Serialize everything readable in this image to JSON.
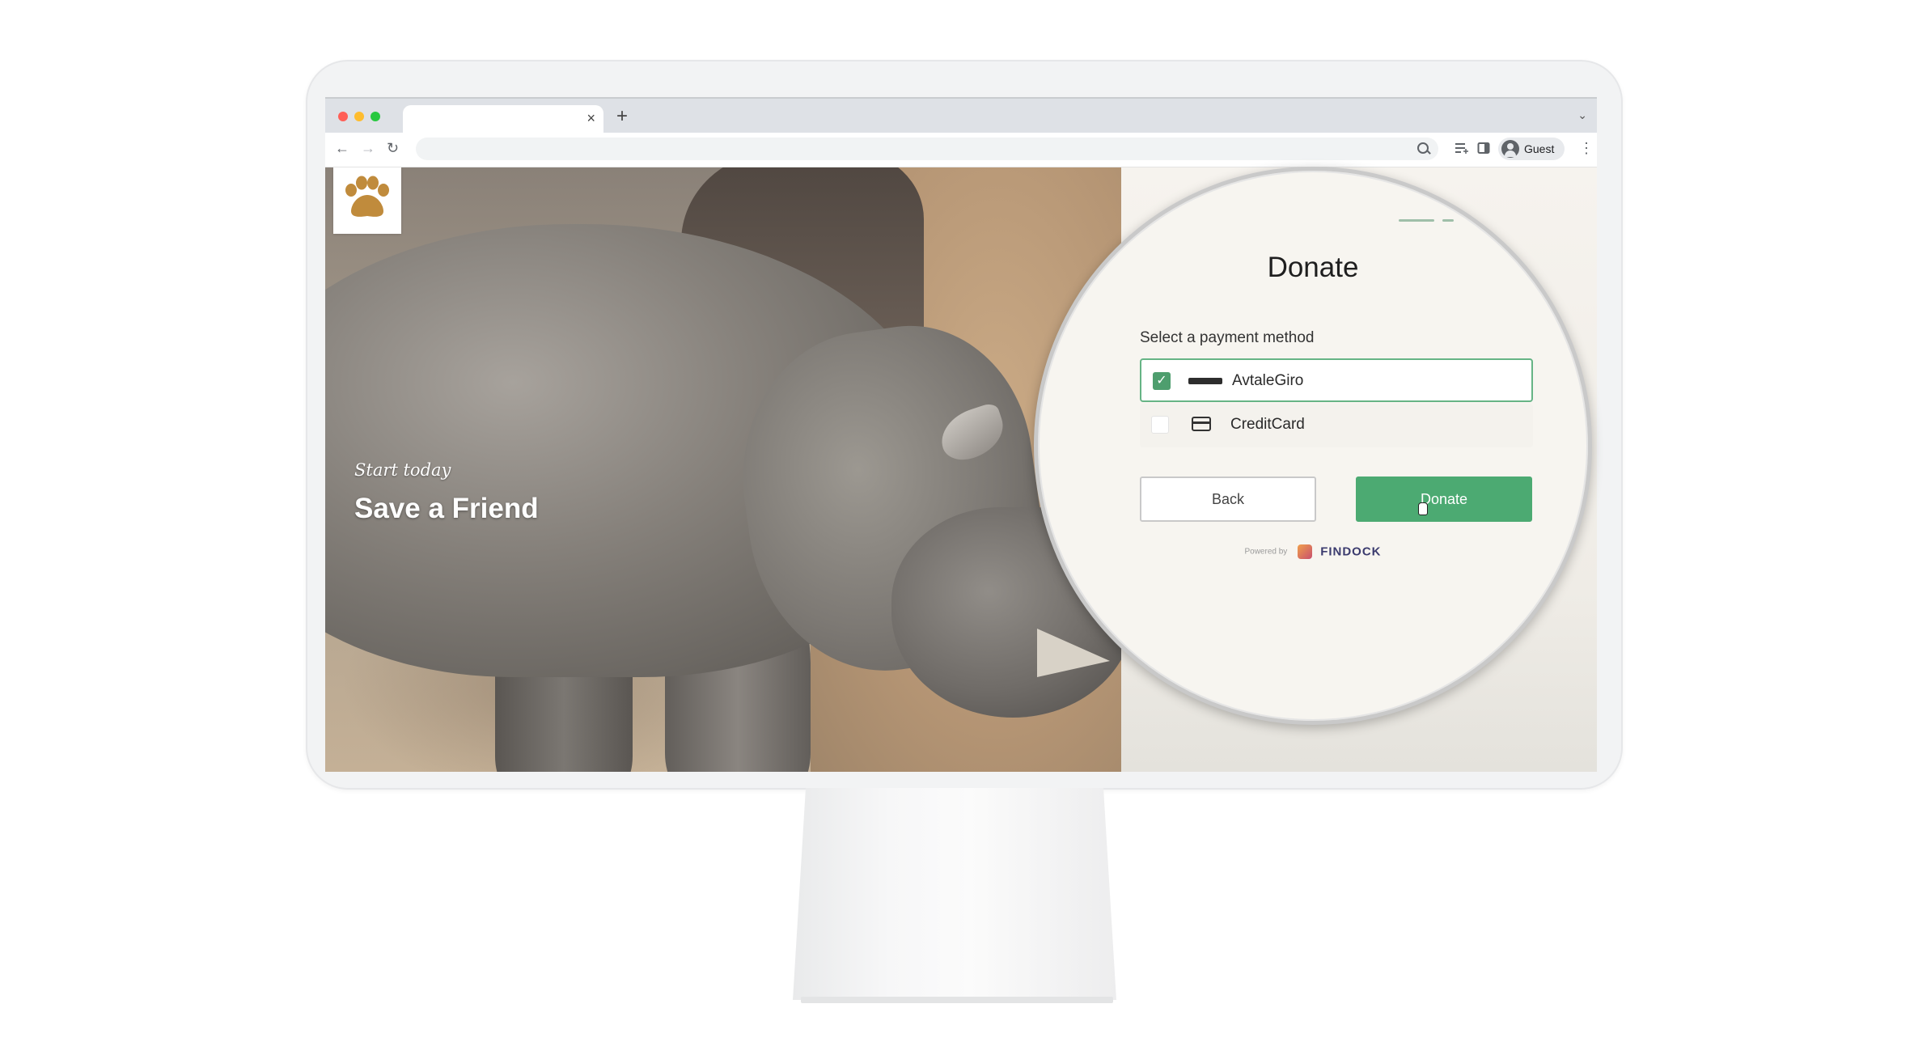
{
  "browser": {
    "tab_close_glyph": "×",
    "new_tab_glyph": "+",
    "tab_menu_glyph": "⌄",
    "back_glyph": "←",
    "forward_glyph": "→",
    "reload_glyph": "↻",
    "profile_label": "Guest",
    "menu_glyph": "⋮",
    "traffic_colors": [
      "#ff5f57",
      "#febc2e",
      "#28c840"
    ]
  },
  "hero": {
    "kicker": "Start today",
    "title": "Save a Friend"
  },
  "donate_form": {
    "title": "Donate",
    "payment_label": "Select a payment method",
    "methods": [
      {
        "name": "AvtaleGiro",
        "selected": true,
        "icon": "avtalegiro-logo-icon"
      },
      {
        "name": "CreditCard",
        "selected": false,
        "icon": "credit-card-icon"
      }
    ],
    "check_glyph": "✓",
    "back_label": "Back",
    "donate_label": "Donate",
    "powered_by": "Powered by",
    "brand": "FINDOCK",
    "accent_color": "#4caa72"
  }
}
